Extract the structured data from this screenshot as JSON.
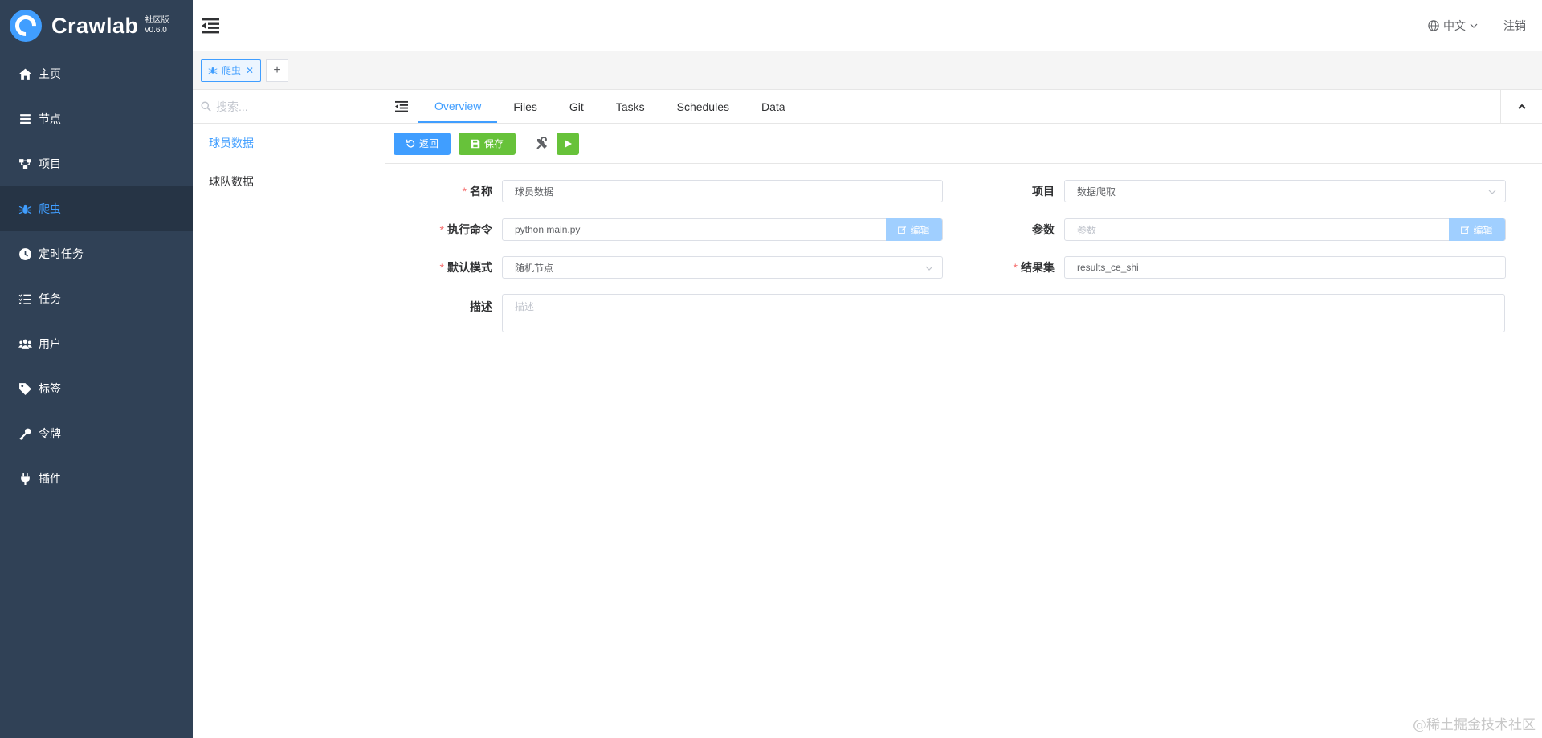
{
  "app": {
    "name": "Crawlab",
    "edition": "社区版",
    "version": "v0.6.0"
  },
  "sidebar": {
    "items": [
      {
        "label": "主页",
        "icon": "home-icon"
      },
      {
        "label": "节点",
        "icon": "server-icon"
      },
      {
        "label": "项目",
        "icon": "project-icon"
      },
      {
        "label": "爬虫",
        "icon": "spider-icon",
        "active": true
      },
      {
        "label": "定时任务",
        "icon": "clock-icon"
      },
      {
        "label": "任务",
        "icon": "task-list-icon"
      },
      {
        "label": "用户",
        "icon": "users-icon"
      },
      {
        "label": "标签",
        "icon": "tag-icon"
      },
      {
        "label": "令牌",
        "icon": "key-icon"
      },
      {
        "label": "插件",
        "icon": "plug-icon"
      }
    ]
  },
  "header": {
    "language": "中文",
    "logout": "注销"
  },
  "page_tabs": {
    "active_tab": "爬虫",
    "add": "+"
  },
  "spider_list": {
    "search_placeholder": "搜索...",
    "items": [
      "球员数据",
      "球队数据"
    ]
  },
  "detail_tabs": [
    "Overview",
    "Files",
    "Git",
    "Tasks",
    "Schedules",
    "Data"
  ],
  "toolbar": {
    "back": "返回",
    "save": "保存"
  },
  "form": {
    "name_label": "名称",
    "name_value": "球员数据",
    "project_label": "项目",
    "project_value": "数据爬取",
    "cmd_label": "执行命令",
    "cmd_value": "python main.py",
    "edit_label": "编辑",
    "param_label": "参数",
    "param_placeholder": "参数",
    "mode_label": "默认模式",
    "mode_value": "随机节点",
    "col_label": "结果集",
    "col_value": "results_ce_shi",
    "desc_label": "描述",
    "desc_placeholder": "描述"
  },
  "watermark": "@稀土掘金技术社区",
  "colors": {
    "sidebar_bg": "#304156",
    "primary": "#409eff",
    "success": "#67c23a",
    "required": "#f56c6c"
  }
}
